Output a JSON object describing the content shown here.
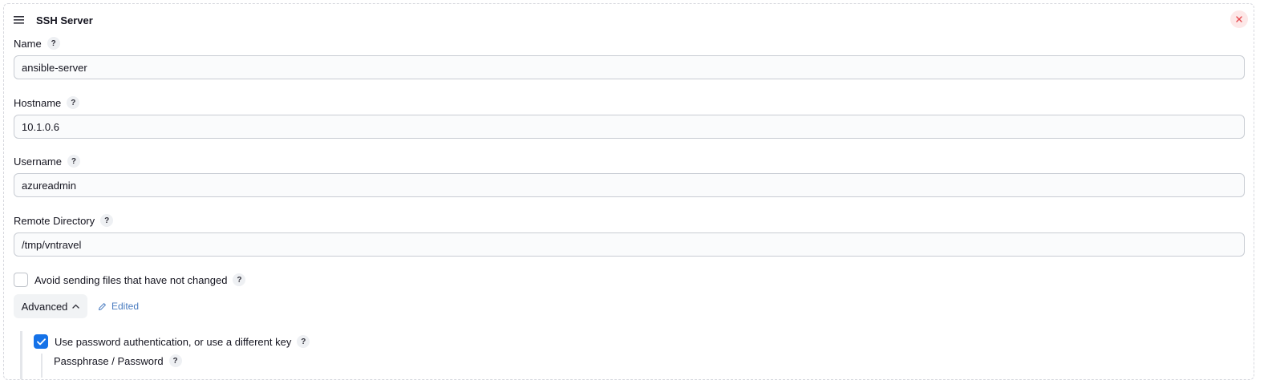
{
  "section": {
    "title": "SSH Server",
    "close_glyph": "×"
  },
  "fields": [
    {
      "label": "Name",
      "value": "ansible-server"
    },
    {
      "label": "Hostname",
      "value": "10.1.0.6"
    },
    {
      "label": "Username",
      "value": "azureadmin"
    },
    {
      "label": "Remote Directory",
      "value": "/tmp/vntravel"
    }
  ],
  "help_glyph": "?",
  "avoid_sending": {
    "label": "Avoid sending files that have not changed",
    "checked": false
  },
  "advanced": {
    "label": "Advanced",
    "expanded": true,
    "edited_label": "Edited"
  },
  "password_auth": {
    "label": "Use password authentication, or use a different key",
    "checked": true
  },
  "passphrase": {
    "label": "Passphrase / Password"
  },
  "colors": {
    "accent": "#1572e8",
    "danger": "#e5484d",
    "edited": "#4a7cc0"
  }
}
